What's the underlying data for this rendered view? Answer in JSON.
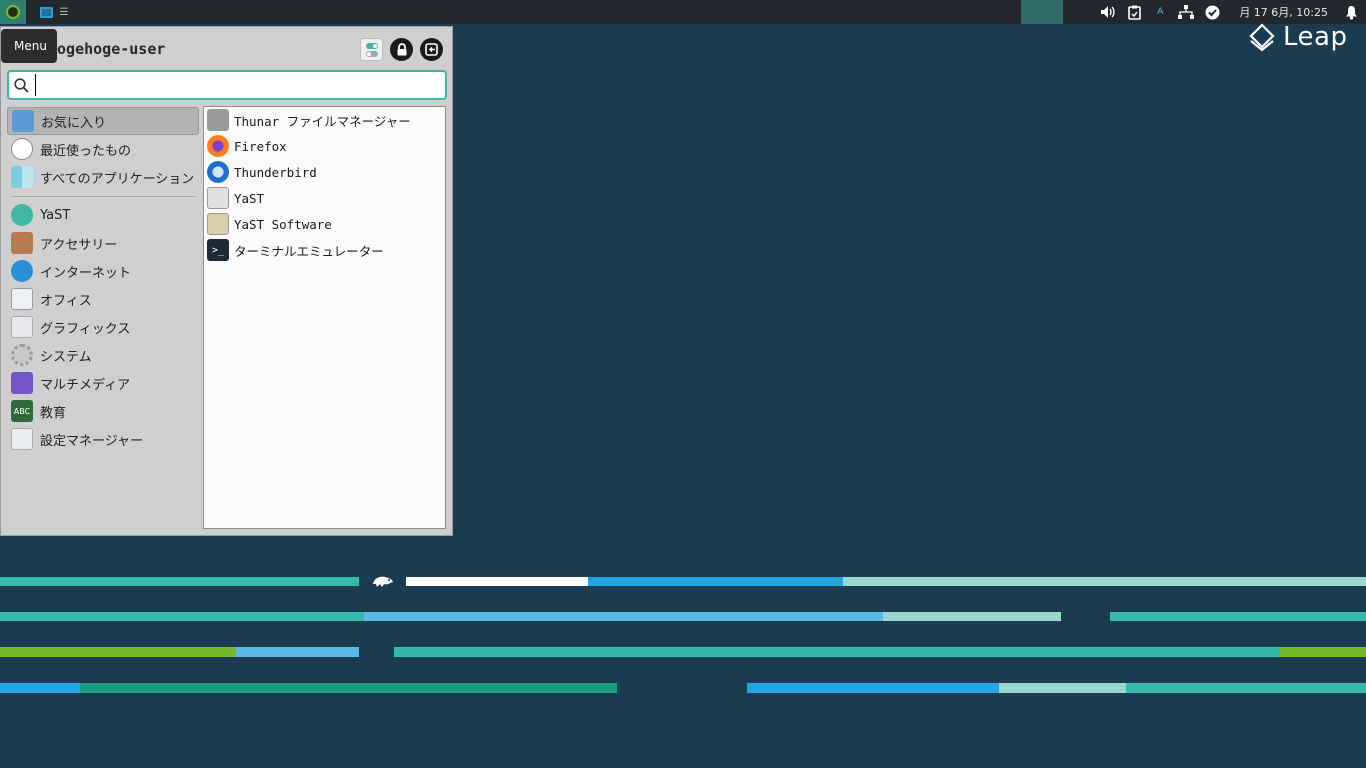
{
  "colors": {
    "desktop": "#1b3c50",
    "panel": "#23282b",
    "accent": "#3fb7a5",
    "stripe_teal": "#35b9ab",
    "stripe_blue": "#21a4df",
    "stripe_light_blue": "#5ab8e6",
    "stripe_pale": "#9ad8cf",
    "stripe_white": "#ffffff",
    "stripe_green": "#73ba25",
    "stripe_dark_teal": "#1a9e83"
  },
  "panel": {
    "menu_button_icon": "opensuse-icon",
    "task_button_icon": "monitor-icon",
    "tray": {
      "keyboard_layout": "A",
      "clock": "月 17  6月, 10:25"
    }
  },
  "menu": {
    "tooltip": "Menu",
    "username": "hogehoge-user",
    "search": {
      "value": "",
      "placeholder": ""
    },
    "categories": [
      {
        "label": "お気に入り",
        "icon": "favorites-folder-icon",
        "active": true
      },
      {
        "label": "最近使ったもの",
        "icon": "clock-icon",
        "active": false
      },
      {
        "label": "すべてのアプリケーション",
        "icon": "all-apps-icon",
        "active": false
      },
      {
        "label": "YaST",
        "icon": "yast-icon",
        "active": false
      },
      {
        "label": "アクセサリー",
        "icon": "briefcase-icon",
        "active": false
      },
      {
        "label": "インターネット",
        "icon": "globe-icon",
        "active": false
      },
      {
        "label": "オフィス",
        "icon": "office-icon",
        "active": false
      },
      {
        "label": "グラフィックス",
        "icon": "graphics-icon",
        "active": false
      },
      {
        "label": "システム",
        "icon": "gear-icon",
        "active": false
      },
      {
        "label": "マルチメディア",
        "icon": "multimedia-icon",
        "active": false
      },
      {
        "label": "教育",
        "icon": "education-icon",
        "active": false
      },
      {
        "label": "設定マネージャー",
        "icon": "settings-manager-icon",
        "active": false
      }
    ],
    "apps": [
      {
        "label": "Thunar ファイルマネージャー",
        "icon": "file-manager-icon"
      },
      {
        "label": "Firefox",
        "icon": "firefox-icon"
      },
      {
        "label": "Thunderbird",
        "icon": "thunderbird-icon"
      },
      {
        "label": "YaST",
        "icon": "yast-control-icon"
      },
      {
        "label": "YaST Software",
        "icon": "yast-software-icon"
      },
      {
        "label": "ターミナルエミュレーター",
        "icon": "terminal-icon"
      }
    ]
  },
  "desktop": {
    "logo_text": "Leap"
  }
}
